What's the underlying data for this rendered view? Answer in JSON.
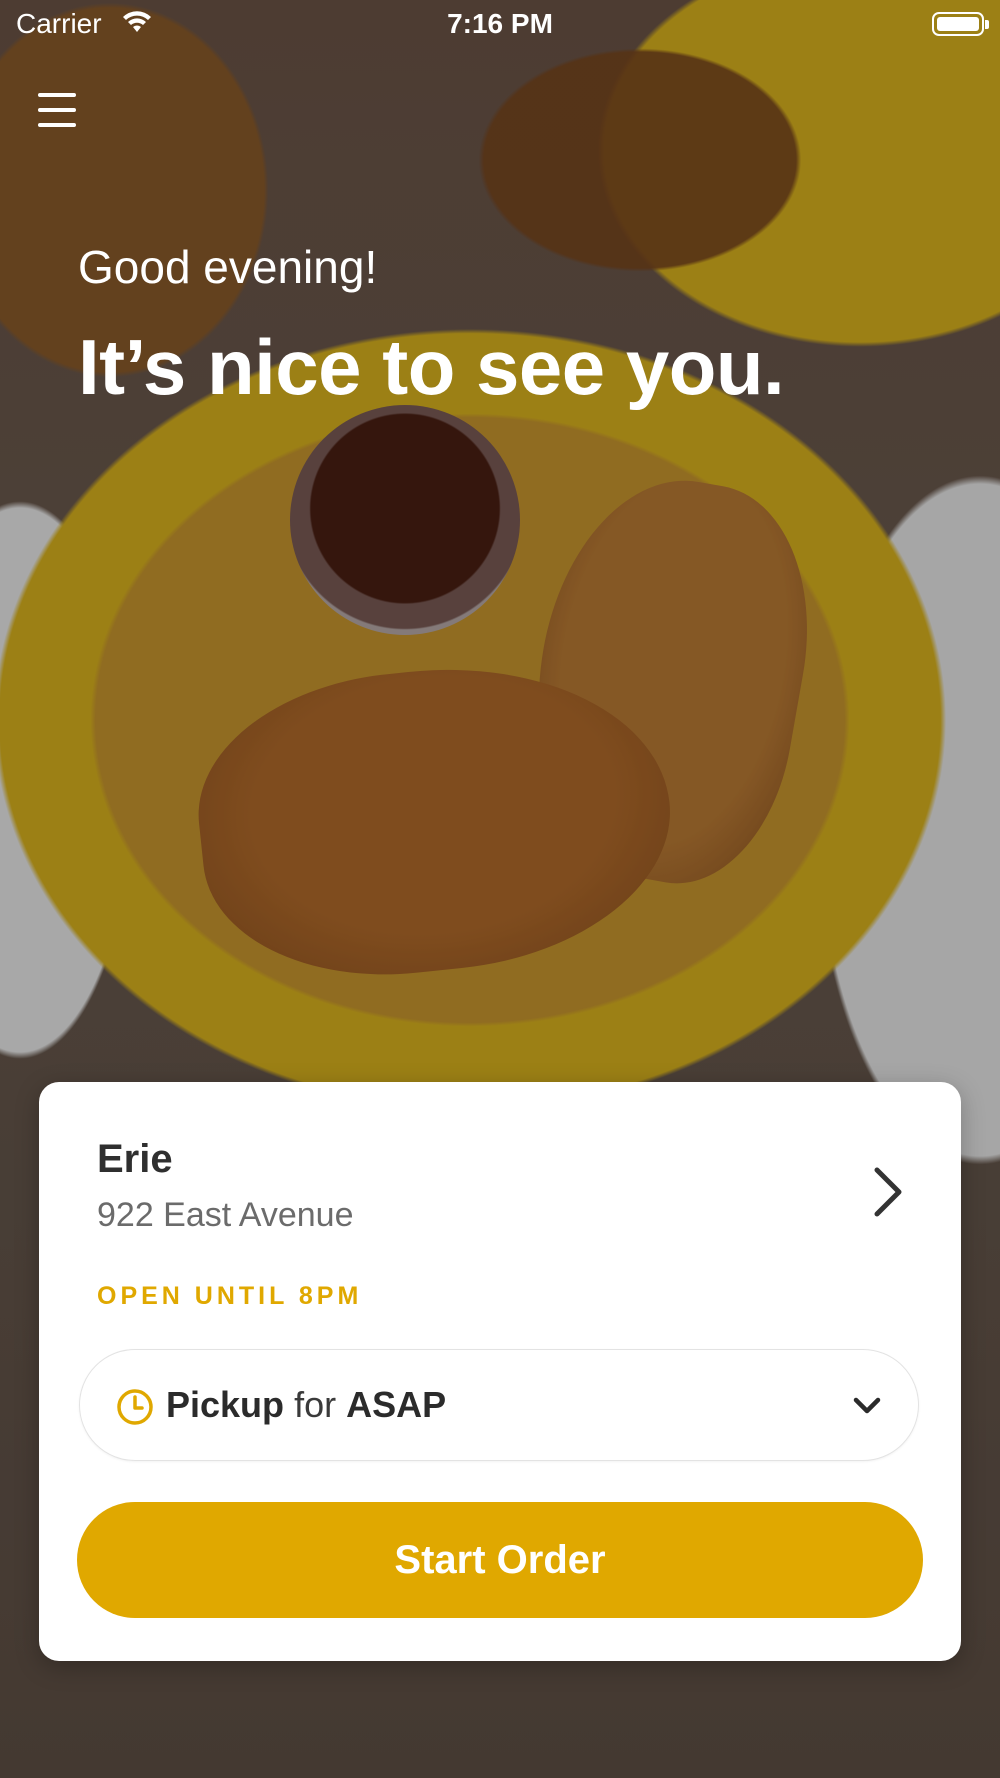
{
  "status_bar": {
    "carrier": "Carrier",
    "time": "7:16 PM"
  },
  "header": {
    "greeting": "Good evening!",
    "headline": "It’s nice to see you."
  },
  "store": {
    "name": "Erie",
    "address": "922 East Avenue",
    "hours": "OPEN UNTIL 8PM"
  },
  "order_mode": {
    "mode": "Pickup",
    "connector": "for",
    "time": "ASAP"
  },
  "actions": {
    "start_order": "Start Order"
  },
  "colors": {
    "accent": "#e0a800",
    "text_dark": "#2f2f2f",
    "text_muted": "#6b6b6b"
  },
  "icons": {
    "menu": "hamburger-menu-icon",
    "store_chevron": "chevron-right-icon",
    "pickup_clock": "clock-icon",
    "dropdown": "chevron-down-icon"
  }
}
